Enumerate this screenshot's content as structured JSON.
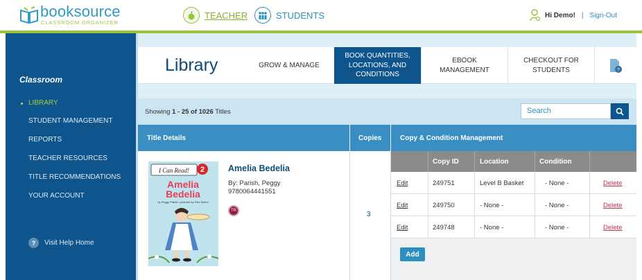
{
  "brand": {
    "name": "booksource",
    "tagline": "CLASSROOM ORGANIZER"
  },
  "topnav": {
    "teacher": "TEACHER",
    "students": "STUDENTS"
  },
  "user": {
    "greeting": "Hi Demo!",
    "separator": "|",
    "signout": "Sign-Out"
  },
  "sidebar": {
    "title": "Classroom",
    "items": [
      {
        "label": "LIBRARY",
        "active": true
      },
      {
        "label": "STUDENT MANAGEMENT"
      },
      {
        "label": "REPORTS"
      },
      {
        "label": "TEACHER RESOURCES"
      },
      {
        "label": "TITLE RECOMMENDATIONS"
      },
      {
        "label": "YOUR ACCOUNT"
      }
    ],
    "help": "Visit Help Home"
  },
  "page": {
    "title": "Library"
  },
  "tabs": [
    {
      "label": "GROW & MANAGE"
    },
    {
      "label": "BOOK QUANTITIES, LOCATIONS, AND CONDITIONS",
      "active": true
    },
    {
      "label": "EBOOK MANAGEMENT"
    },
    {
      "label": "CHECKOUT FOR STUDENTS"
    }
  ],
  "listing": {
    "prefix": "Showing ",
    "range": "1 - 25 of 1026",
    "suffix": " Titles"
  },
  "search": {
    "placeholder": "Search"
  },
  "table": {
    "headers": {
      "title": "Title Details",
      "copies": "Copies",
      "copy_mgmt": "Copy & Condition Management"
    },
    "sub_headers": {
      "copy_id": "Copy ID",
      "location": "Location",
      "condition": "Condition"
    }
  },
  "book": {
    "title": "Amelia Bedelia",
    "author": "By: Parish, Peggy",
    "isbn": "9780064441551",
    "badge": "TR",
    "copies": "3",
    "cover": {
      "series": "I Can Read!",
      "level": "2",
      "title_line1": "Amelia",
      "title_line2": "Bedelia",
      "byline": "by Peggy Parish • pictures by Fritz Siebel"
    },
    "copy_rows": [
      {
        "edit": "Edit",
        "copy_id": "249751",
        "location": "Level B Basket",
        "condition": "- None -",
        "delete": "Delete"
      },
      {
        "edit": "Edit",
        "copy_id": "249750",
        "location": "- None -",
        "condition": "- None -",
        "delete": "Delete"
      },
      {
        "edit": "Edit",
        "copy_id": "249748",
        "location": "- None -",
        "condition": "- None -",
        "delete": "Delete"
      }
    ],
    "add_label": "Add"
  },
  "colors": {
    "primary": "#0d558c",
    "accent_green": "#9ac43c",
    "link_blue": "#2c8fc0",
    "header_blue": "#3a8fc2",
    "delete_red": "#c9334b"
  }
}
